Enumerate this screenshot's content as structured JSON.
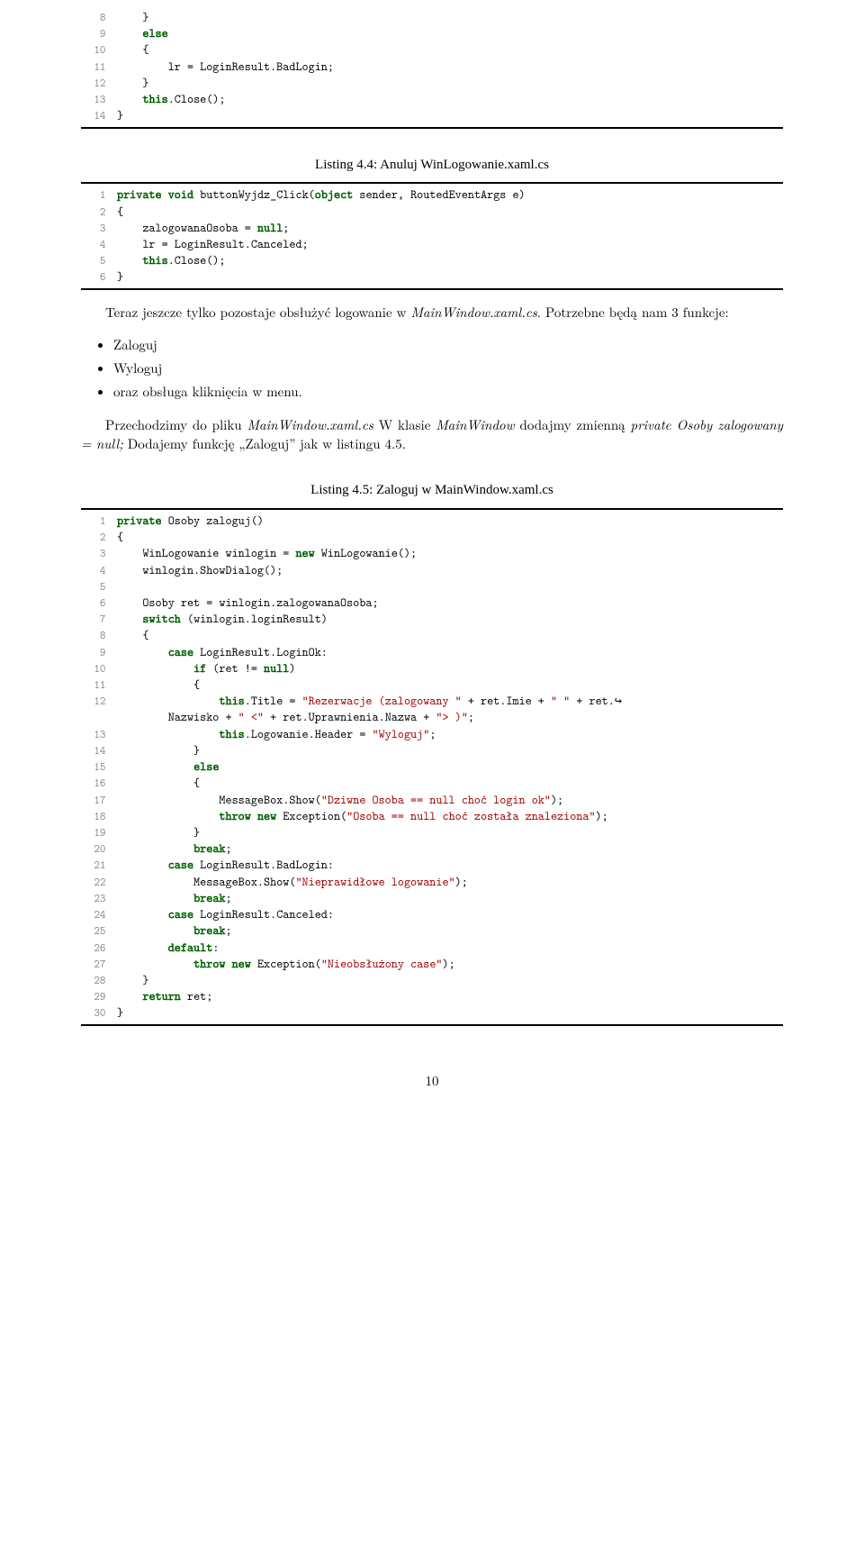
{
  "listing_a": {
    "lines": [
      {
        "n": "8",
        "t": "    }"
      },
      {
        "n": "9",
        "t": "    <kw>else</kw>"
      },
      {
        "n": "10",
        "t": "    {"
      },
      {
        "n": "11",
        "t": "        lr = LoginResult.BadLogin;"
      },
      {
        "n": "12",
        "t": "    }"
      },
      {
        "n": "13",
        "t": "    <kw>this</kw>.Close();"
      },
      {
        "n": "14",
        "t": "}"
      }
    ]
  },
  "caption_4_4": "Listing 4.4: Anuluj WinLogowanie.xaml.cs",
  "listing_b": {
    "lines": [
      {
        "n": "1",
        "t": "<kw>private</kw> <kw>void</kw> buttonWyjdz_Click(<kw>object</kw> sender, RoutedEventArgs e)"
      },
      {
        "n": "2",
        "t": "{"
      },
      {
        "n": "3",
        "t": "    zalogowanaOsoba = <kw>null</kw>;"
      },
      {
        "n": "4",
        "t": "    lr = LoginResult.Canceled;"
      },
      {
        "n": "5",
        "t": "    <kw>this</kw>.Close();"
      },
      {
        "n": "6",
        "t": "}"
      }
    ]
  },
  "para1_a": "Teraz jeszcze tylko pozostaje obsłużyć logowanie w ",
  "para1_b": "MainWindow.xaml.cs",
  "para1_c": ". Potrzebne będą nam 3 funkcje:",
  "bullets": [
    "Zaloguj",
    "Wyloguj",
    "oraz obsługa kliknięcia w menu."
  ],
  "para2_a": "Przechodzimy do pliku ",
  "para2_b": "MainWindow.xaml.cs",
  "para2_c": " W klasie ",
  "para2_d": "MainWindow",
  "para2_e": " dodajmy zmienną ",
  "para2_f": "private Osoby zalogowany = null;",
  "para2_g": " Dodajemy funkcję „Zaloguj” jak w listingu 4.5.",
  "caption_4_5": "Listing 4.5: Zaloguj w MainWindow.xaml.cs",
  "listing_c": {
    "lines": [
      {
        "n": "1",
        "t": "<kw>private</kw> Osoby zaloguj()"
      },
      {
        "n": "2",
        "t": "{"
      },
      {
        "n": "3",
        "t": "    WinLogowanie winlogin = <kw>new</kw> WinLogowanie();"
      },
      {
        "n": "4",
        "t": "    winlogin.ShowDialog();"
      },
      {
        "n": "5",
        "t": ""
      },
      {
        "n": "6",
        "t": "    Osoby ret = winlogin.zalogowanaOsoba;"
      },
      {
        "n": "7",
        "t": "    <kw>switch</kw> (winlogin.loginResult)"
      },
      {
        "n": "8",
        "t": "    {"
      },
      {
        "n": "9",
        "t": "        <kw>case</kw> LoginResult.LoginOk:"
      },
      {
        "n": "10",
        "t": "            <kw>if</kw> (ret != <kw>null</kw>)"
      },
      {
        "n": "11",
        "t": "            {"
      },
      {
        "n": "12",
        "t": "                <kw>this</kw>.Title = <str>\"Rezerwacje (zalogowany \"</str> + ret.Imie + <str>\" \"</str> + ret.<wa>↪</wa>"
      },
      {
        "n": "",
        "t": "        Nazwisko + <str>\" &lt;\"</str> + ret.Uprawnienia.Nazwa + <str>\"&gt; )\"</str>;"
      },
      {
        "n": "13",
        "t": "                <kw>this</kw>.Logowanie.Header = <str>\"Wyloguj\"</str>;"
      },
      {
        "n": "14",
        "t": "            }"
      },
      {
        "n": "15",
        "t": "            <kw>else</kw>"
      },
      {
        "n": "16",
        "t": "            {"
      },
      {
        "n": "17",
        "t": "                MessageBox.Show(<str>\"Dziwne Osoba == null choć login ok\"</str>);"
      },
      {
        "n": "18",
        "t": "                <kw>throw</kw> <kw>new</kw> Exception(<str>\"Osoba == null choć została znaleziona\"</str>);"
      },
      {
        "n": "19",
        "t": "            }"
      },
      {
        "n": "20",
        "t": "            <kw>break</kw>;"
      },
      {
        "n": "21",
        "t": "        <kw>case</kw> LoginResult.BadLogin:"
      },
      {
        "n": "22",
        "t": "            MessageBox.Show(<str>\"Nieprawidłowe logowanie\"</str>);"
      },
      {
        "n": "23",
        "t": "            <kw>break</kw>;"
      },
      {
        "n": "24",
        "t": "        <kw>case</kw> LoginResult.Canceled:"
      },
      {
        "n": "25",
        "t": "            <kw>break</kw>;"
      },
      {
        "n": "26",
        "t": "        <kw>default</kw>:"
      },
      {
        "n": "27",
        "t": "            <kw>throw</kw> <kw>new</kw> Exception(<str>\"Nieobsłużony case\"</str>);"
      },
      {
        "n": "28",
        "t": "    }"
      },
      {
        "n": "29",
        "t": "    <kw>return</kw> ret;"
      },
      {
        "n": "30",
        "t": "}"
      }
    ]
  },
  "page_number": "10"
}
